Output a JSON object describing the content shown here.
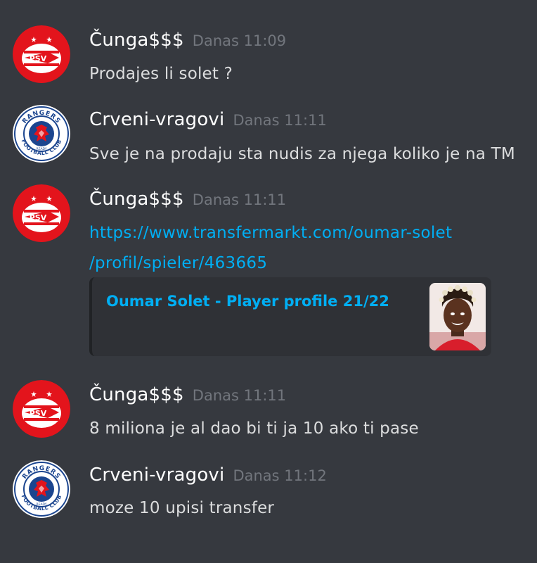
{
  "messages": [
    {
      "username": "Čunga$$$",
      "time": "Danas 11:09",
      "text": "Prodajes li solet ?"
    },
    {
      "username": "Crveni-vragovi",
      "time": "Danas 11:11",
      "text": "Sve je na prodaju sta nudis za njega koliko je na TM"
    },
    {
      "username": "Čunga$$$",
      "time": "Danas 11:11",
      "link_line1": "https://www.transfermarkt.com/oumar-solet",
      "link_line2": "/profil/spieler/463665",
      "embed": {
        "title": "Oumar Solet - Player profile 21/22",
        "thumbnail": "player-photo"
      }
    },
    {
      "username": "Čunga$$$",
      "time": "Danas 11:11",
      "text": "8 miliona je al dao bi ti ja 10 ako ti pase"
    },
    {
      "username": "Crveni-vragovi",
      "time": "Danas 11:12",
      "text": "moze 10 upisi transfer"
    }
  ],
  "avatars": {
    "psv": {
      "logo_text": "PSV",
      "icon": "psv-logo"
    },
    "rangers": {
      "logo_text": "RANGERS",
      "sub_text": "FOOTBALL CLUB",
      "ready_text": "READY",
      "icon": "rangers-logo"
    }
  },
  "colors": {
    "background": "#36393f",
    "username": "#ffffff",
    "timestamp": "#72767d",
    "message_text": "#dcddde",
    "link": "#00aff4",
    "embed_bg": "#2f3136",
    "psv_red": "#e3141c",
    "rangers_blue": "#1b458f"
  }
}
